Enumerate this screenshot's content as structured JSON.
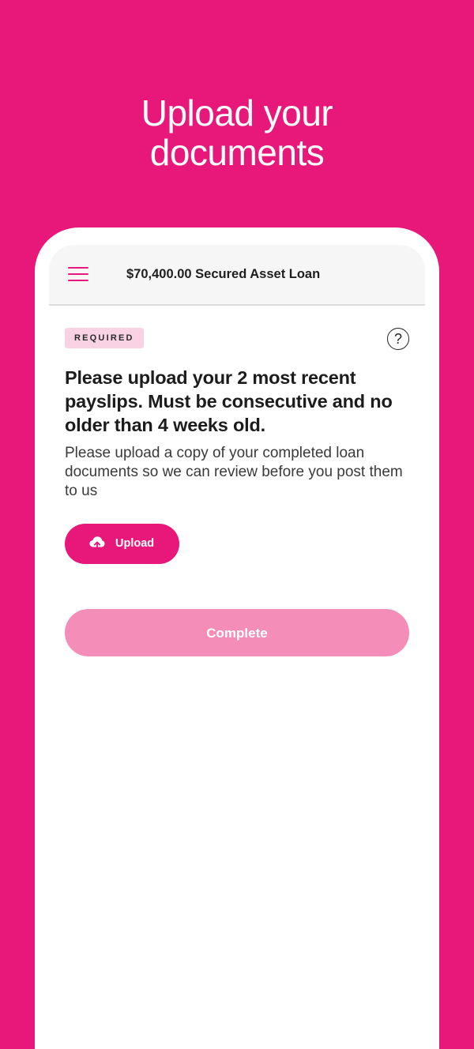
{
  "promo": {
    "title_line1": "Upload your",
    "title_line2": "documents"
  },
  "header": {
    "title": "$70,400.00 Secured Asset Loan",
    "menu_icon": "hamburger-menu-icon"
  },
  "card": {
    "badge": "REQUIRED",
    "help_icon": "question-mark-icon",
    "help_glyph": "?",
    "heading": "Please upload your 2 most recent payslips. Must be consecutive and no older than 4 weeks old.",
    "description": "Please upload a copy of your completed loan documents so we can review before you post them to us",
    "upload_label": "Upload",
    "upload_icon": "cloud-upload-icon",
    "complete_label": "Complete"
  },
  "colors": {
    "brand": "#E8177A",
    "complete_disabled": "#F48DB8",
    "badge_bg": "#F9D3E3"
  }
}
